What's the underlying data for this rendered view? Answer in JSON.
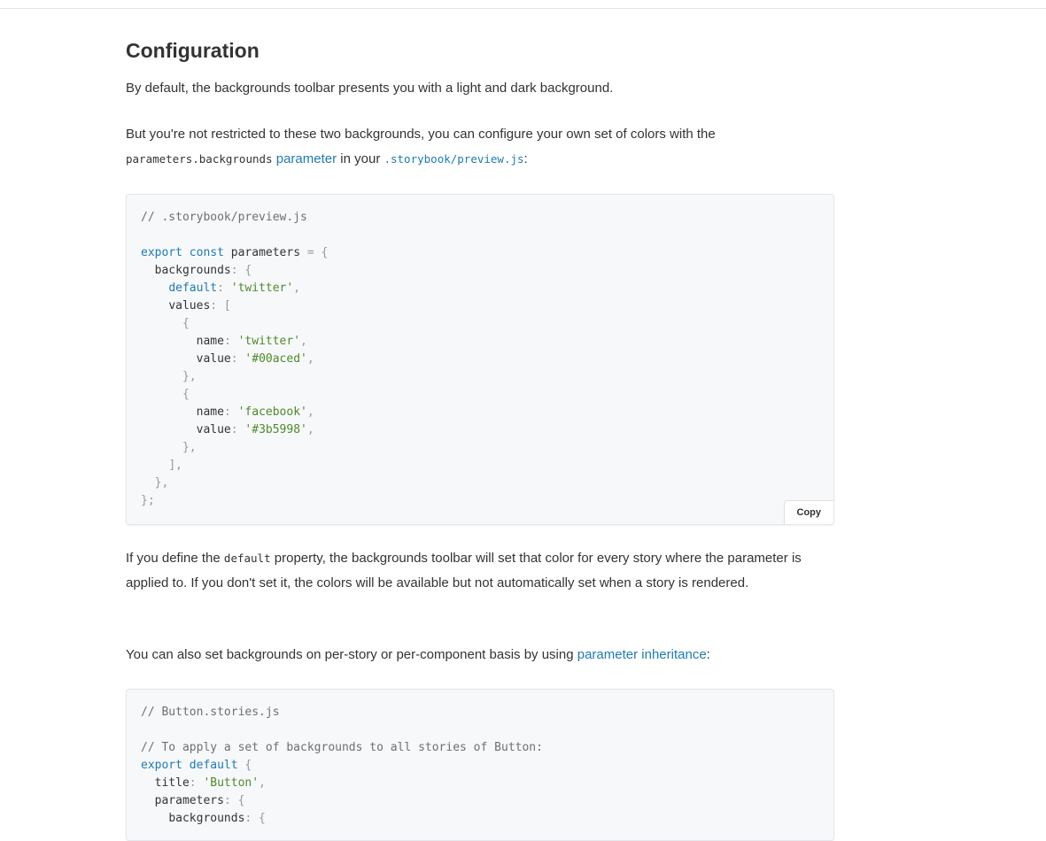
{
  "heading": "Configuration",
  "p1": "By default, the backgrounds toolbar presents you with a light and dark background.",
  "p2": {
    "text_a": "But you're not restricted to these two backgrounds, you can configure your own set of colors with the",
    "code_a": "parameters.backgrounds",
    "link": "parameter",
    "text_b": " in your ",
    "code_b": ".storybook/preview.js",
    "text_c": ":"
  },
  "code1": {
    "comment": "// .storybook/preview.js",
    "line_export": "export const parameters = {",
    "backgrounds_key": "backgrounds",
    "default_key": "default",
    "default_val": "'twitter'",
    "values_key": "values",
    "name_key": "name",
    "value_key": "value",
    "item1_name": "'twitter'",
    "item1_value": "'#00aced'",
    "item2_name": "'facebook'",
    "item2_value": "'#3b5998'",
    "copy_label": "Copy"
  },
  "p3": {
    "text_a": "If you define the ",
    "code": "default",
    "text_b": " property, the backgrounds toolbar will set that color for every story where the parameter is applied to. If you don't set it, the colors will be available but not automatically set when a story is rendered."
  },
  "p4": {
    "text_a": "You can also set backgrounds on per-story or per-component basis by using ",
    "link": "parameter inheritance",
    "text_b": ":"
  },
  "code2": {
    "comment1": "// Button.stories.js",
    "comment2": "// To apply a set of backgrounds to all stories of Button:",
    "export_kw": "export default",
    "title_key": "title",
    "title_val": "'Button'",
    "parameters_key": "parameters",
    "backgrounds_key": "backgrounds"
  }
}
